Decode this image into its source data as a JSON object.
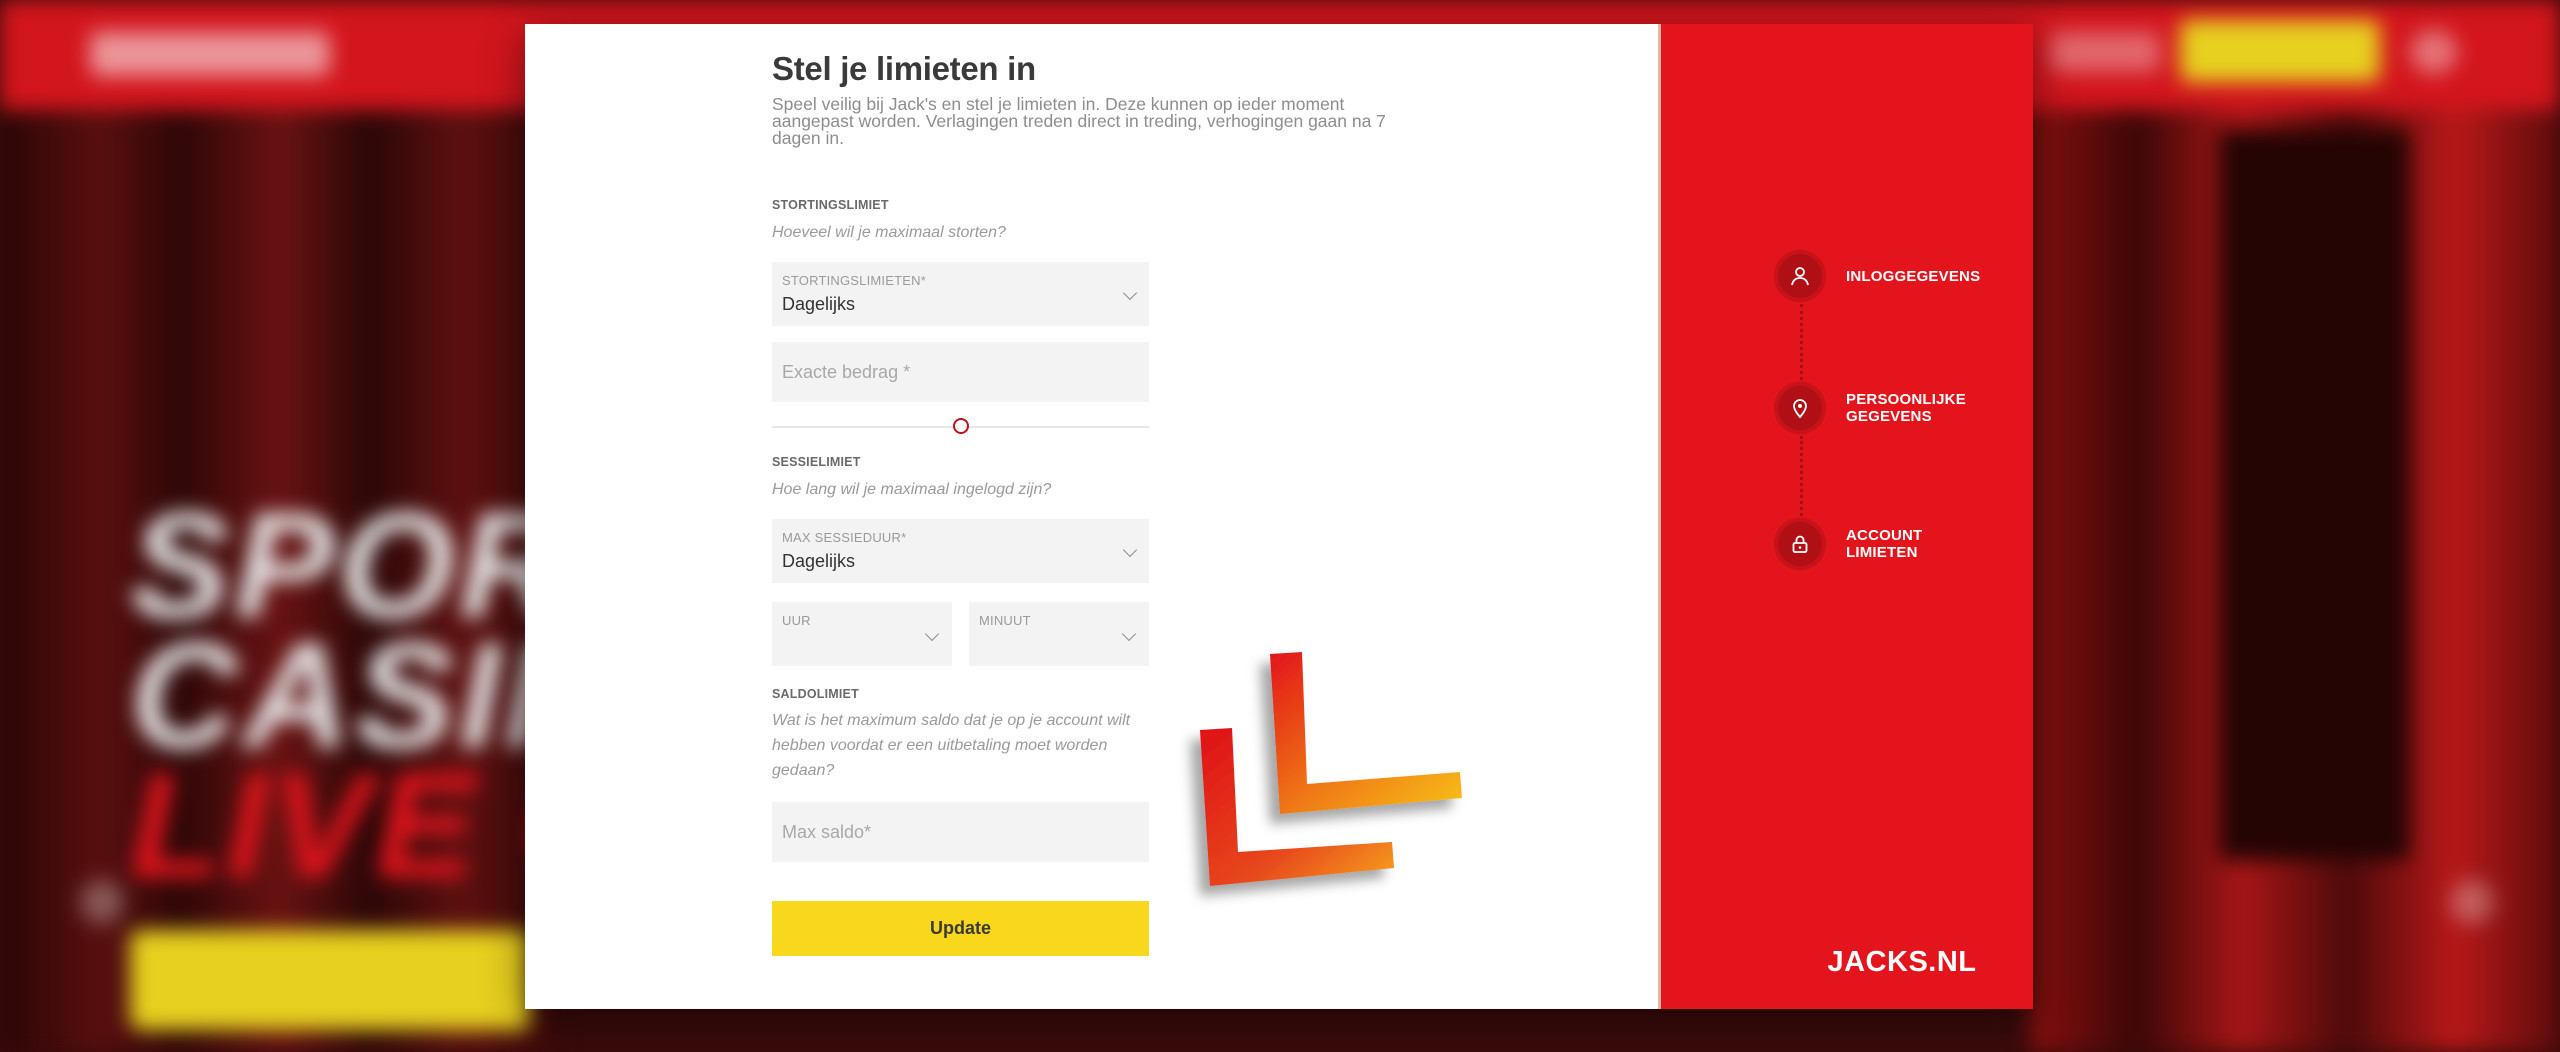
{
  "background": {
    "hero_lines": [
      "SPORT",
      "CASINO",
      "LIVE C"
    ]
  },
  "form": {
    "title": "Stel je limieten in",
    "intro": "Speel veilig bij Jack's en stel je limieten in. Deze kunnen op ieder moment aangepast worden. Verlagingen treden direct in treding, verhogingen gaan na 7 dagen in.",
    "deposit": {
      "section_label": "STORTINGSLIMIET",
      "hint": "Hoeveel wil je maximaal storten?",
      "period_label": "STORTINGSLIMIETEN*",
      "period_value": "Dagelijks",
      "amount_placeholder": "Exacte bedrag *"
    },
    "session": {
      "section_label": "SESSIELIMIET",
      "hint": "Hoe lang wil je maximaal ingelogd zijn?",
      "duration_label": "MAX SESSIEDUUR*",
      "duration_value": "Dagelijks",
      "hour_label": "UUR",
      "minute_label": "MINUUT"
    },
    "balance": {
      "section_label": "SALDOLIMIET",
      "hint": "Wat is het maximum saldo dat je op je account wilt hebben voordat er een uitbetaling moet worden gedaan?",
      "max_placeholder": "Max saldo*"
    },
    "update_label": "Update"
  },
  "stepper": [
    {
      "label": "INLOGGEGEVENS",
      "icon": "user-icon"
    },
    {
      "label": "PERSOONLIJKE GEGEVENS",
      "icon": "location-pin-icon"
    },
    {
      "label": "ACCOUNT LIMIETEN",
      "icon": "lock-icon"
    }
  ],
  "brand": {
    "logo_text": "JACKS.NL"
  },
  "colors": {
    "brand_red": "#e3141c",
    "button_yellow": "#f9d71c"
  }
}
